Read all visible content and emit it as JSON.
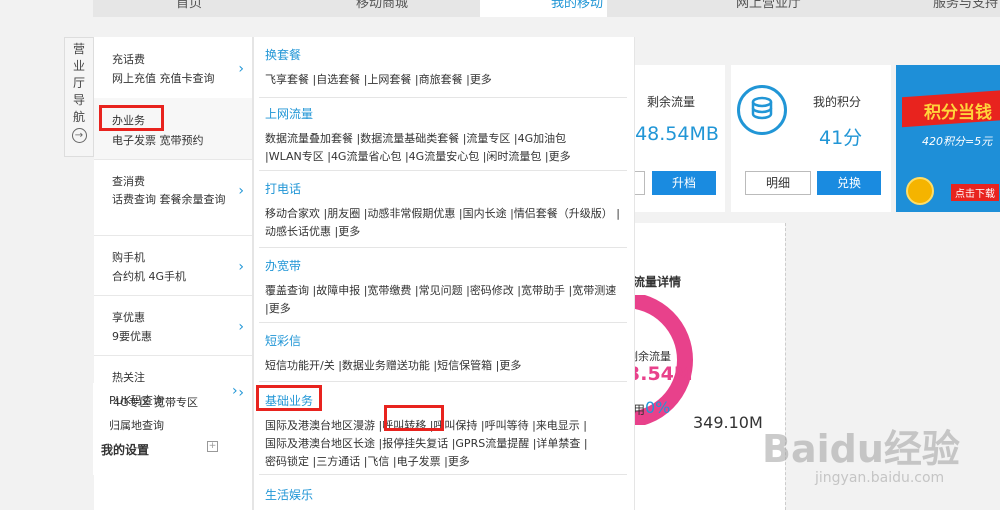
{
  "top_nav": {
    "tabs": [
      {
        "label": "首页"
      },
      {
        "label": "移动商城"
      },
      {
        "label": "我的移动",
        "active": true
      },
      {
        "label": "网上营业厅"
      },
      {
        "label": "服务与支持"
      }
    ]
  },
  "guide": {
    "chars": [
      "营",
      "业",
      "厅",
      "导",
      "航"
    ],
    "icon": "arrow-right-circle-icon"
  },
  "left_menu": [
    {
      "title": "充话费",
      "sub": "网上充值   充值卡查询"
    },
    {
      "title": "办业务",
      "sub": "电子发票   宽带预约"
    },
    {
      "title": "查消费",
      "sub": "话费查询   套餐余量查询"
    },
    {
      "title": "购手机",
      "sub": "合约机   4G手机"
    },
    {
      "title": "享优惠",
      "sub": "9要优惠"
    },
    {
      "title": "热关注",
      "sub": ""
    }
  ],
  "sub_menu": {
    "items": [
      "PUK码查询",
      "4G专区   宽带专区",
      "归属地查询"
    ],
    "settings_label": "我的设置",
    "settings_icon": "plus-square-icon"
  },
  "mega_menu": {
    "sections": [
      {
        "title": "换套餐",
        "links": [
          "飞享套餐",
          "自选套餐",
          "上网套餐",
          "商旅套餐",
          "更多"
        ]
      },
      {
        "title": "上网流量",
        "links": [
          "数据流量叠加套餐",
          "数据流量基础类套餐",
          "流量专区",
          "4G加油包",
          "WLAN专区",
          "4G流量省心包",
          "4G流量安心包",
          "闲时流量包",
          "更多"
        ]
      },
      {
        "title": "打电话",
        "links": [
          "移动合家欢",
          "朋友圈",
          "动感非常假期优惠",
          "国内长途",
          "情侣套餐（升级版）",
          "动感长话优惠",
          "更多"
        ]
      },
      {
        "title": "办宽带",
        "links": [
          "覆盖查询",
          "故障申报",
          "宽带缴费",
          "常见问题",
          "密码修改",
          "宽带助手",
          "宽带测速",
          "更多"
        ]
      },
      {
        "title": "短彩信",
        "links": [
          "短信功能开/关",
          "数据业务赠送功能",
          "短信保管箱",
          "更多"
        ]
      },
      {
        "title": "基础业务",
        "links": [
          "国际及港澳台地区漫游",
          "呼叫转移",
          "呼叫保持",
          "呼叫等待",
          "来电显示",
          "国际及港澳台地区长途",
          "报停挂失复话",
          "GPRS流量提醒",
          "详单禁查",
          "密码锁定",
          "三方通话",
          "飞信",
          "电子发票",
          "更多"
        ]
      },
      {
        "title": "生活娱乐",
        "links": []
      }
    ]
  },
  "account_panel": {
    "remaining_flow_label": "剩余流量",
    "remaining_flow_value": "348.54MB",
    "upgrade_button": "升档",
    "points_label": "我的积分",
    "points_value": "41分",
    "points_icon": "coins-stack-icon",
    "detail_button": "明细",
    "redeem_button": "兑换",
    "banner_text_1": "积分当钱",
    "banner_text_2": "420积分=5元",
    "banner_text_3": "点击下载"
  },
  "flow_detail": {
    "title": "流量详情",
    "remaining_label": "剩余流量",
    "remaining_value": "3.54M",
    "used_label": "用",
    "used_percent": "0%",
    "total_value": "349.10M",
    "remaining_fraction": 1.0
  },
  "watermark": {
    "brand": "Baidu经验",
    "url": "jingyan.baidu.com"
  },
  "colors": {
    "accent": "#2196d6",
    "button_blue": "#1a8be0",
    "highlight_red": "#e8231e",
    "donut_pink": "#e8418b",
    "banner_blue": "#1e8fd8"
  }
}
